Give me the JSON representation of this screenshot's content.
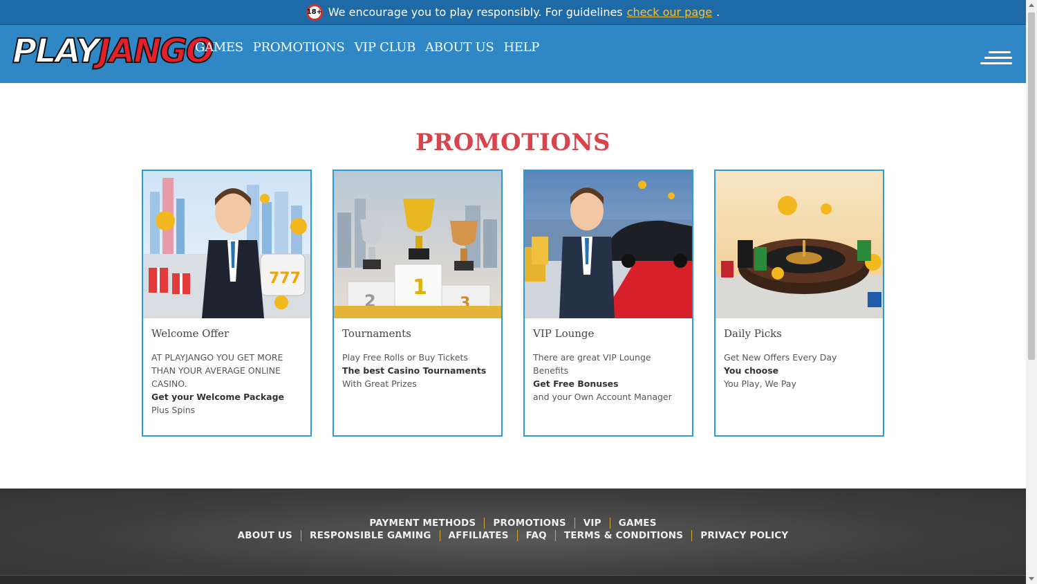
{
  "topbar": {
    "age_badge": "18+",
    "message": "We encourage you to play responsibly. For guidelines",
    "link_text": "check our page",
    "period": "."
  },
  "header": {
    "logo_play": "PLAY",
    "logo_jango": "JANGO",
    "nav": [
      "GAMES",
      "PROMOTIONS",
      "VIP CLUB",
      "ABOUT US",
      "HELP"
    ],
    "menu_icon": "hamburger-icon"
  },
  "main": {
    "title": "PROMOTIONS",
    "cards": [
      {
        "title": "Welcome Offer",
        "lines": [
          "AT PLAYJANGO YOU GET MORE THAN YOUR AVERAGE ONLINE CASINO.",
          "Get your Welcome Package",
          "Plus Spins"
        ],
        "image": "businessman-with-gifts-and-slot-machine-image"
      },
      {
        "title": "Tournaments",
        "lines": [
          "Play Free Rolls or Buy Tickets",
          "The best Casino Tournaments",
          "With Great Prizes"
        ],
        "image": "trophies-on-podium-image"
      },
      {
        "title": "VIP Lounge",
        "lines": [
          "There are great VIP Lounge Benefits",
          "Get Free Bonuses",
          "and your Own Account Manager"
        ],
        "image": "businessman-with-limousine-image"
      },
      {
        "title": "Daily Picks",
        "lines": [
          "Get New Offers Every Day",
          "You choose",
          "You Play, We Pay"
        ],
        "image": "roulette-wheel-with-chips-image"
      }
    ]
  },
  "footer": {
    "row1": [
      "PAYMENT METHODS",
      "PROMOTIONS",
      "VIP",
      "GAMES"
    ],
    "row2": [
      "ABOUT US",
      "RESPONSIBLE GAMING",
      "AFFILIATES",
      "FAQ",
      "TERMS & CONDITIONS",
      "PRIVACY POLICY"
    ]
  },
  "colors": {
    "topbar": "#1e6aa6",
    "header": "#2f87c6",
    "title_red": "#d9434c",
    "card_border": "#2b9ad8",
    "footer_divider": "#e2a72e"
  }
}
